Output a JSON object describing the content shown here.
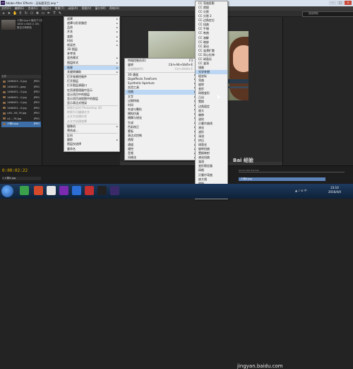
{
  "window": {
    "title": "Adobe After Effects - 无标题项目.aep *",
    "min": "–",
    "max": "□",
    "close": "×"
  },
  "menubar": [
    "文件(F)",
    "编辑(E)",
    "合成(C)",
    "图层(L)",
    "效果(T)",
    "动画(A)",
    "视图(V)",
    "窗口(W)",
    "帮助(H)"
  ],
  "search": {
    "placeholder": "搜索帮助"
  },
  "project": {
    "item_name": "人物4.jpg ▾ 使用了1次",
    "item_size": "1800 x 848 (1.00)",
    "item_info": "数百万种颜色",
    "columns": "名称",
    "files": [
      {
        "name": "1466453...5.jpg",
        "type": "JPEG"
      },
      {
        "name": "1466453...jpeg",
        "type": "JPEG"
      },
      {
        "name": "1466452...3.jpg",
        "type": "JPEG"
      },
      {
        "name": "1466452...2.jpg",
        "type": "JPEG"
      },
      {
        "name": "1466452...1.jpg",
        "type": "JPEG"
      },
      {
        "name": "1466452...9.jpg",
        "type": "JPEG"
      },
      {
        "name": "u46...06_76.jpg",
        "type": "JPEG"
      },
      {
        "name": "u4-...76.jpg",
        "type": "JPEG"
      },
      {
        "name": "人物4.jpg",
        "type": "JPEG",
        "selected": true
      }
    ]
  },
  "menu1": [
    {
      "label": "遮罩",
      "arrow": true
    },
    {
      "label": "遮罩与形状路径",
      "arrow": true
    },
    {
      "label": "品质",
      "arrow": true
    },
    {
      "label": "开关",
      "arrow": true
    },
    {
      "label": "变换",
      "arrow": true
    },
    {
      "label": "时间",
      "arrow": true
    },
    {
      "label": "帧混合",
      "arrow": true
    },
    {
      "label": "3D 图层"
    },
    {
      "label": "参考线"
    },
    {
      "label": "混合模式",
      "arrow": true
    },
    {
      "label": "图层样式",
      "arrow": true
    },
    {
      "sep": true
    },
    {
      "label": "效果",
      "arrow": true,
      "highlight": true
    },
    {
      "label": "关键帧辅助",
      "arrow": true
    },
    {
      "sep": true
    },
    {
      "label": "打开效果控制件"
    },
    {
      "label": "打开图层"
    },
    {
      "label": "打开图层源窗口"
    },
    {
      "label": "在资源管理器中显示"
    },
    {
      "label": "显示项目中的图层"
    },
    {
      "label": "显示项目流程图中的图层"
    },
    {
      "label": "显示表达式错误"
    },
    {
      "sep": true
    },
    {
      "label": "转换为实时 Photoshop 3D",
      "disabled": true
    },
    {
      "label": "转换为可编辑文字",
      "disabled": true
    },
    {
      "label": "从文字创建形状",
      "disabled": true
    },
    {
      "label": "从文字创建遮罩",
      "disabled": true
    },
    {
      "sep": true
    },
    {
      "label": "摄像机",
      "arrow": true
    },
    {
      "label": "预合成..."
    },
    {
      "sep": true
    },
    {
      "label": "反向"
    },
    {
      "label": "跟踪",
      "arrow": true
    },
    {
      "label": "图层仅选择"
    },
    {
      "label": "重命名"
    }
  ],
  "menu2": [
    {
      "label": "特效控制台(E)",
      "shortcut": "F3"
    },
    {
      "label": "旋转",
      "shortcut": "Ctrl+Alt+Shift+E"
    },
    {
      "label": "全部移除(R)",
      "shortcut": "Ctrl+Shift+E",
      "disabled": true
    },
    {
      "sep": true
    },
    {
      "label": "3D 通道",
      "arrow": true
    },
    {
      "label": "Digieffects FreeForm",
      "arrow": true
    },
    {
      "label": "Synthetic Aperture",
      "arrow": true
    },
    {
      "label": "实用工具",
      "arrow": true
    },
    {
      "label": "扭曲",
      "arrow": true,
      "highlight": true
    },
    {
      "label": "文字",
      "arrow": true
    },
    {
      "label": "过期特效",
      "arrow": true
    },
    {
      "label": "时间",
      "arrow": true
    },
    {
      "label": "杂波与颗粒",
      "arrow": true
    },
    {
      "label": "模拟仿真",
      "arrow": true
    },
    {
      "label": "模糊与锐化",
      "arrow": true
    },
    {
      "label": "生成",
      "arrow": true
    },
    {
      "label": "色彩校正",
      "arrow": true
    },
    {
      "label": "蒙板",
      "arrow": true
    },
    {
      "label": "表达式控制",
      "arrow": true
    },
    {
      "label": "透视",
      "arrow": true
    },
    {
      "label": "通道",
      "arrow": true
    },
    {
      "label": "键控",
      "arrow": true
    },
    {
      "label": "音频",
      "arrow": true
    },
    {
      "label": "风格化",
      "arrow": true
    }
  ],
  "menu3": [
    {
      "label": "CC 弯曲投影"
    },
    {
      "label": "CC 透镜"
    },
    {
      "label": "CC 分割"
    },
    {
      "label": "CC 分割 2"
    },
    {
      "label": "CC 边角定位"
    },
    {
      "label": "CC 扭曲"
    },
    {
      "label": "CC 平铺"
    },
    {
      "label": "CC 卷曲"
    },
    {
      "label": "CC 溶解"
    },
    {
      "label": "CC 缩放"
    },
    {
      "label": "CC 滚动"
    },
    {
      "label": "CC 涟漪扩散"
    },
    {
      "label": "CC 同心拉伸"
    },
    {
      "label": "CC 球面化"
    },
    {
      "label": "CC 漩涡"
    },
    {
      "label": "镜像"
    },
    {
      "label": "光学补偿",
      "highlight": true
    },
    {
      "label": "极坐标"
    },
    {
      "label": "弯曲"
    },
    {
      "label": "旋转"
    },
    {
      "label": "变形"
    },
    {
      "label": "网格变形"
    },
    {
      "label": "凸出"
    },
    {
      "label": "置换"
    },
    {
      "label": "边角固定"
    },
    {
      "label": "放大"
    },
    {
      "label": "偏移"
    },
    {
      "label": "波纹"
    },
    {
      "label": "贝塞尔曲线"
    },
    {
      "label": "液化"
    },
    {
      "label": "波形"
    },
    {
      "label": "湍流"
    },
    {
      "label": "挤压"
    },
    {
      "label": "球面化"
    },
    {
      "label": "旋转扭曲"
    },
    {
      "label": "置换映射"
    },
    {
      "label": "液化扭曲"
    },
    {
      "label": "漩涡"
    },
    {
      "label": "变形稳定器"
    },
    {
      "label": "网格"
    },
    {
      "label": "贝塞尔弯曲"
    },
    {
      "label": "放大镜"
    },
    {
      "label": "偏移"
    },
    {
      "label": "波纹"
    },
    {
      "label": "湍流置换"
    },
    {
      "label": "卷页"
    }
  ],
  "timeline": {
    "timecode": "0:00:02:22",
    "layer_label": "1  人物4.jpg",
    "bar_label": "人物4.jpg",
    "ruler": "0s  01s  02s  03s  04s"
  },
  "taskbar": {
    "time": "23:10",
    "date": "2016/4/4",
    "tray": "▲ ♪ ⊞ 中"
  },
  "watermark": {
    "logo": "Bai 经验",
    "url": "jingyan.baidu.com"
  }
}
